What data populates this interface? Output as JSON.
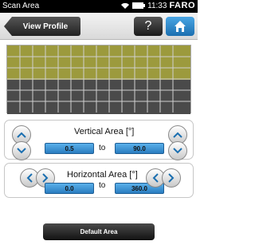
{
  "statusbar": {
    "title": "Scan Area",
    "time": "11:33",
    "brand": "FARO"
  },
  "toolbar": {
    "back_label": "View Profile",
    "help_label": "?"
  },
  "vertical": {
    "label": "Vertical Area [°]",
    "min": "0.5",
    "to": "to",
    "max": "90.0"
  },
  "horizontal": {
    "label": "Horizontal Area [°]",
    "min": "0.0",
    "to": "to",
    "max": "360.0"
  },
  "footer": {
    "default_label": "Default Area"
  },
  "colors": {
    "accent": "#2a7dc0",
    "upper_area": "#9c9a3d",
    "lower_area": "#4a4a4a"
  }
}
